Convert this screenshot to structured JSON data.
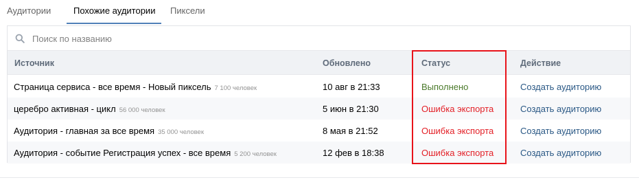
{
  "tabs": [
    {
      "label": "Аудитории",
      "active": false
    },
    {
      "label": "Похожие аудитории",
      "active": true
    },
    {
      "label": "Пиксели",
      "active": false
    }
  ],
  "search": {
    "placeholder": "Поиск по названию",
    "value": ""
  },
  "table": {
    "columns": [
      "Источник",
      "Обновлено",
      "Статус",
      "Действие"
    ],
    "rows": [
      {
        "source": "Страница сервиса - все время - Новый пиксель",
        "count": "7 100 человек",
        "updated": "10 авг в 21:33",
        "status": "Выполнено",
        "status_type": "ok",
        "action": "Создать аудиторию"
      },
      {
        "source": "церебро активная - цикл",
        "count": "56 000 человек",
        "updated": "5 июн в 21:30",
        "status": "Ошибка экспорта",
        "status_type": "error",
        "action": "Создать аудиторию"
      },
      {
        "source": "Аудитория - главная  за все время",
        "count": "35 000 человек",
        "updated": "8 мая в 21:52",
        "status": "Ошибка экспорта",
        "status_type": "error",
        "action": "Создать аудиторию"
      },
      {
        "source": "Аудитория - событие Регистрация успех - все время",
        "count": "5 200 человек",
        "updated": "12 фев в 18:38",
        "status": "Ошибка экспорта",
        "status_type": "error",
        "action": "Создать аудиторию"
      }
    ]
  },
  "colors": {
    "accent": "#5181b8",
    "link": "#2a5885",
    "ok": "#4b7a2b",
    "error": "#e32027",
    "highlight": "#e8131a"
  }
}
